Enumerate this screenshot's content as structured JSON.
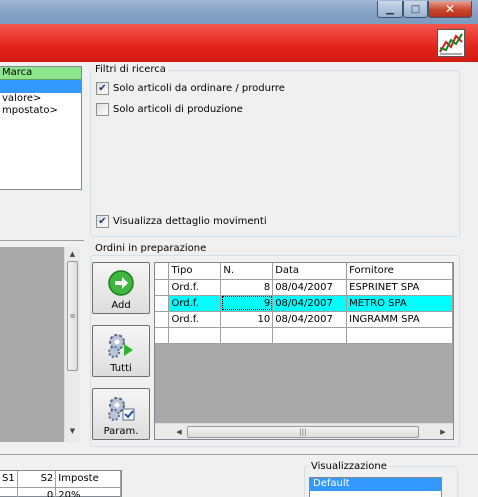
{
  "window": {
    "minimize_glyph": "▁",
    "maximize_glyph": "□",
    "close_glyph": "✕"
  },
  "left_panel": {
    "header": "Marca",
    "items": [
      "valore>",
      "mpostato>"
    ]
  },
  "filters": {
    "legend": "Filtri di ricerca",
    "cb1": {
      "label": "Solo articoli da ordinare / produrre",
      "checked": true
    },
    "cb2": {
      "label": "Solo articoli di produzione",
      "checked": false
    },
    "cb3": {
      "label": "Visualizza dettaglio movimenti",
      "checked": true
    }
  },
  "orders": {
    "legend": "Ordini in preparazione",
    "buttons": {
      "add": "Add",
      "all": "Tutti",
      "params": "Param."
    },
    "columns": [
      "Tipo",
      "N.",
      "Data",
      "Fornitore"
    ],
    "rows": [
      {
        "tipo": "Ord.f.",
        "n": "8",
        "data": "08/04/2007",
        "fornitore": "ESPRINET SPA"
      },
      {
        "tipo": "Ord.f.",
        "n": "9",
        "data": "08/04/2007",
        "fornitore": "METRO SPA"
      },
      {
        "tipo": "Ord.f.",
        "n": "10",
        "data": "08/04/2007",
        "fornitore": "INGRAMM SPA"
      }
    ],
    "selected_row": 1
  },
  "bottom_grid": {
    "headers": [
      "S1",
      "S2",
      "Imposte"
    ],
    "row": [
      "",
      "0",
      "20%"
    ]
  },
  "visualizzazione": {
    "legend": "Visualizzazione",
    "items": [
      "Default"
    ]
  },
  "colors": {
    "banner": "#e2241c",
    "selection_cyan": "#00ffff",
    "list_selection": "#3399ff"
  }
}
